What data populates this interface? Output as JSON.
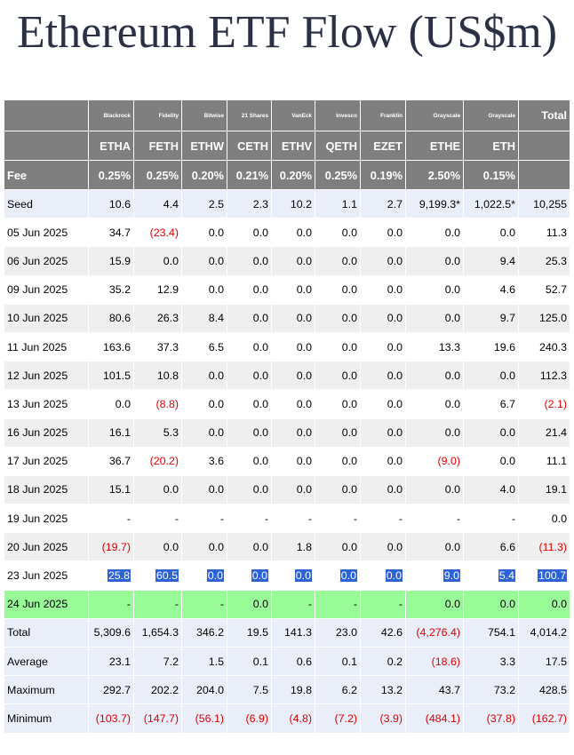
{
  "title": "Ethereum ETF Flow (US$m)",
  "colors": {
    "header_bg": "#7f7f7f",
    "blue_row": "#e9eef9",
    "grey_row": "#efefef",
    "green_row": "#98fb98",
    "negative": "#e00000",
    "highlight": "#2d63d6"
  },
  "issuers": [
    "Blackrock",
    "Fidelity",
    "Bitwise",
    "21 Shares",
    "VanEck",
    "Invesco",
    "Franklin",
    "Grayscale",
    "Grayscale"
  ],
  "total_header": "Total",
  "tickers": [
    "ETHA",
    "FETH",
    "ETHW",
    "CETH",
    "ETHV",
    "QETH",
    "EZET",
    "ETHE",
    "ETH"
  ],
  "fee_label": "Fee",
  "fees": [
    "0.25%",
    "0.25%",
    "0.20%",
    "0.21%",
    "0.20%",
    "0.25%",
    "0.19%",
    "2.50%",
    "0.15%"
  ],
  "rows": [
    {
      "label": "Seed",
      "style": "blue",
      "cells": [
        "10.6",
        "4.4",
        "2.5",
        "2.3",
        "10.2",
        "1.1",
        "2.7",
        "9,199.3*",
        "1,022.5*",
        "10,255"
      ]
    },
    {
      "label": "05 Jun 2025",
      "style": "white",
      "cells": [
        "34.7",
        "(23.4)",
        "0.0",
        "0.0",
        "0.0",
        "0.0",
        "0.0",
        "0.0",
        "0.0",
        "11.3"
      ]
    },
    {
      "label": "06 Jun 2025",
      "style": "grey",
      "cells": [
        "15.9",
        "0.0",
        "0.0",
        "0.0",
        "0.0",
        "0.0",
        "0.0",
        "0.0",
        "9.4",
        "25.3"
      ]
    },
    {
      "label": "09 Jun 2025",
      "style": "white",
      "cells": [
        "35.2",
        "12.9",
        "0.0",
        "0.0",
        "0.0",
        "0.0",
        "0.0",
        "0.0",
        "4.6",
        "52.7"
      ]
    },
    {
      "label": "10 Jun 2025",
      "style": "grey",
      "cells": [
        "80.6",
        "26.3",
        "8.4",
        "0.0",
        "0.0",
        "0.0",
        "0.0",
        "0.0",
        "9.7",
        "125.0"
      ]
    },
    {
      "label": "11 Jun 2025",
      "style": "white",
      "cells": [
        "163.6",
        "37.3",
        "6.5",
        "0.0",
        "0.0",
        "0.0",
        "0.0",
        "13.3",
        "19.6",
        "240.3"
      ]
    },
    {
      "label": "12 Jun 2025",
      "style": "grey",
      "cells": [
        "101.5",
        "10.8",
        "0.0",
        "0.0",
        "0.0",
        "0.0",
        "0.0",
        "0.0",
        "0.0",
        "112.3"
      ]
    },
    {
      "label": "13 Jun 2025",
      "style": "white",
      "cells": [
        "0.0",
        "(8.8)",
        "0.0",
        "0.0",
        "0.0",
        "0.0",
        "0.0",
        "0.0",
        "6.7",
        "(2.1)"
      ]
    },
    {
      "label": "16 Jun 2025",
      "style": "grey",
      "cells": [
        "16.1",
        "5.3",
        "0.0",
        "0.0",
        "0.0",
        "0.0",
        "0.0",
        "0.0",
        "0.0",
        "21.4"
      ]
    },
    {
      "label": "17 Jun 2025",
      "style": "white",
      "cells": [
        "36.7",
        "(20.2)",
        "3.6",
        "0.0",
        "0.0",
        "0.0",
        "0.0",
        "(9.0)",
        "0.0",
        "11.1"
      ]
    },
    {
      "label": "18 Jun 2025",
      "style": "grey",
      "cells": [
        "15.1",
        "0.0",
        "0.0",
        "0.0",
        "0.0",
        "0.0",
        "0.0",
        "0.0",
        "4.0",
        "19.1"
      ]
    },
    {
      "label": "19 Jun 2025",
      "style": "white",
      "cells": [
        "-",
        "-",
        "-",
        "-",
        "-",
        "-",
        "-",
        "-",
        "-",
        "0.0"
      ]
    },
    {
      "label": "20 Jun 2025",
      "style": "grey",
      "cells": [
        "(19.7)",
        "0.0",
        "0.0",
        "0.0",
        "1.8",
        "0.0",
        "0.0",
        "0.0",
        "6.6",
        "(11.3)"
      ]
    },
    {
      "label": "23 Jun 2025",
      "style": "white",
      "highlight": true,
      "cells": [
        "25.8",
        "60.5",
        "0.0",
        "0.0",
        "0.0",
        "0.0",
        "0.0",
        "9.0",
        "5.4",
        "100.7"
      ]
    },
    {
      "label": "24 Jun 2025",
      "style": "green",
      "cells": [
        "-",
        "-",
        "-",
        "0.0",
        "-",
        "-",
        "-",
        "0.0",
        "0.0",
        "0.0"
      ]
    },
    {
      "label": "Total",
      "style": "blue",
      "cells": [
        "5,309.6",
        "1,654.3",
        "346.2",
        "19.5",
        "141.3",
        "23.0",
        "42.6",
        "(4,276.4)",
        "754.1",
        "4,014.2"
      ]
    },
    {
      "label": "Average",
      "style": "blue",
      "cells": [
        "23.1",
        "7.2",
        "1.5",
        "0.1",
        "0.6",
        "0.1",
        "0.2",
        "(18.6)",
        "3.3",
        "17.5"
      ]
    },
    {
      "label": "Maximum",
      "style": "blue",
      "cells": [
        "292.7",
        "202.2",
        "204.0",
        "7.5",
        "19.8",
        "6.2",
        "13.2",
        "43.7",
        "73.2",
        "428.5"
      ]
    },
    {
      "label": "Minimum",
      "style": "blue",
      "cells": [
        "(103.7)",
        "(147.7)",
        "(56.1)",
        "(6.9)",
        "(4.8)",
        "(7.2)",
        "(3.9)",
        "(484.1)",
        "(37.8)",
        "(162.7)"
      ]
    }
  ]
}
